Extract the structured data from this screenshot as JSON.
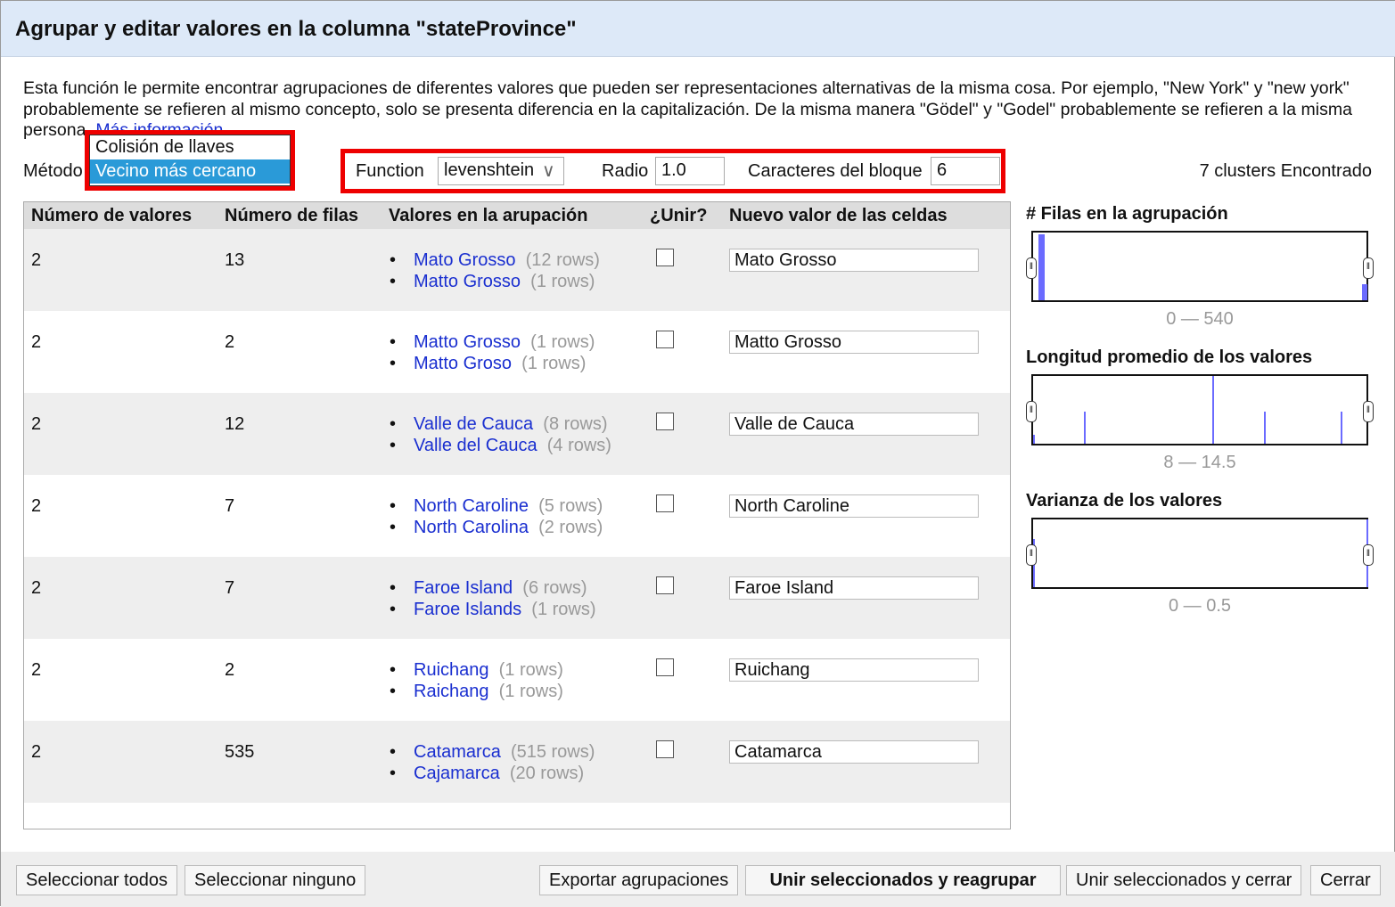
{
  "title": "Agrupar y editar valores en la columna \"stateProvince\"",
  "description": "Esta función le permite encontrar agrupaciones de diferentes valores que pueden ser representaciones alternativas de la misma cosa. Por ejemplo, \"New York\" y \"new york\" probablemente se refieren al mismo concepto, solo se presenta diferencia en la capitalización. De la misma manera \"Gödel\" y \"Godel\" probablemente se refieren a la misma persona.",
  "more_info": "Más información ...",
  "method": {
    "label": "Método",
    "options": [
      "Colisión de llaves",
      "Vecino más cercano"
    ],
    "selected": "Vecino más cercano"
  },
  "params": {
    "function_label": "Function",
    "function_value": "levenshtein",
    "radius_label": "Radio",
    "radius_value": "1.0",
    "block_label": "Caracteres del bloque",
    "block_value": "6"
  },
  "found": "7 clusters Encontrado",
  "columns": [
    "Número de valores",
    "Número de filas",
    "Valores en la arupación",
    "¿Unir?",
    "Nuevo valor de las celdas"
  ],
  "rows": [
    {
      "nvals": "2",
      "nrows": "13",
      "values": [
        {
          "v": "Mato Grosso",
          "c": "(12 rows)"
        },
        {
          "v": "Matto Grosso",
          "c": "(1 rows)"
        }
      ],
      "merge": false,
      "new": "Mato Grosso"
    },
    {
      "nvals": "2",
      "nrows": "2",
      "values": [
        {
          "v": "Matto Grosso",
          "c": "(1 rows)"
        },
        {
          "v": "Matto Groso",
          "c": "(1 rows)"
        }
      ],
      "merge": false,
      "new": "Matto Grosso"
    },
    {
      "nvals": "2",
      "nrows": "12",
      "values": [
        {
          "v": "Valle de Cauca",
          "c": "(8 rows)"
        },
        {
          "v": "Valle del Cauca",
          "c": "(4 rows)"
        }
      ],
      "merge": false,
      "new": "Valle de Cauca"
    },
    {
      "nvals": "2",
      "nrows": "7",
      "values": [
        {
          "v": "North Caroline",
          "c": "(5 rows)"
        },
        {
          "v": "North Carolina",
          "c": "(2 rows)"
        }
      ],
      "merge": false,
      "new": "North Caroline"
    },
    {
      "nvals": "2",
      "nrows": "7",
      "values": [
        {
          "v": "Faroe Island",
          "c": "(6 rows)"
        },
        {
          "v": "Faroe Islands",
          "c": "(1 rows)"
        }
      ],
      "merge": false,
      "new": "Faroe Island"
    },
    {
      "nvals": "2",
      "nrows": "2",
      "values": [
        {
          "v": "Ruichang",
          "c": "(1 rows)"
        },
        {
          "v": "Raichang",
          "c": "(1 rows)"
        }
      ],
      "merge": false,
      "new": "Ruichang"
    },
    {
      "nvals": "2",
      "nrows": "535",
      "values": [
        {
          "v": "Catamarca",
          "c": "(515 rows)"
        },
        {
          "v": "Cajamarca",
          "c": "(20 rows)"
        }
      ],
      "merge": false,
      "new": "Catamarca"
    }
  ],
  "facets": [
    {
      "title": "# Filas en la agrupación",
      "range": "0 — 540"
    },
    {
      "title": "Longitud promedio de los valores",
      "range": "8 — 14.5"
    },
    {
      "title": "Varianza de los valores",
      "range": "0 — 0.5"
    }
  ],
  "buttons": {
    "select_all": "Seleccionar todos",
    "select_none": "Seleccionar ninguno",
    "export": "Exportar agrupaciones",
    "merge_recluster": "Unir seleccionados y reagrupar",
    "merge_close": "Unir seleccionados y cerrar",
    "close": "Cerrar"
  },
  "colors": {
    "accent_highlight": "#e00000",
    "link": "#1a2fd0",
    "selected_option": "#2a9ad8",
    "histogram": "#6b6bff"
  }
}
